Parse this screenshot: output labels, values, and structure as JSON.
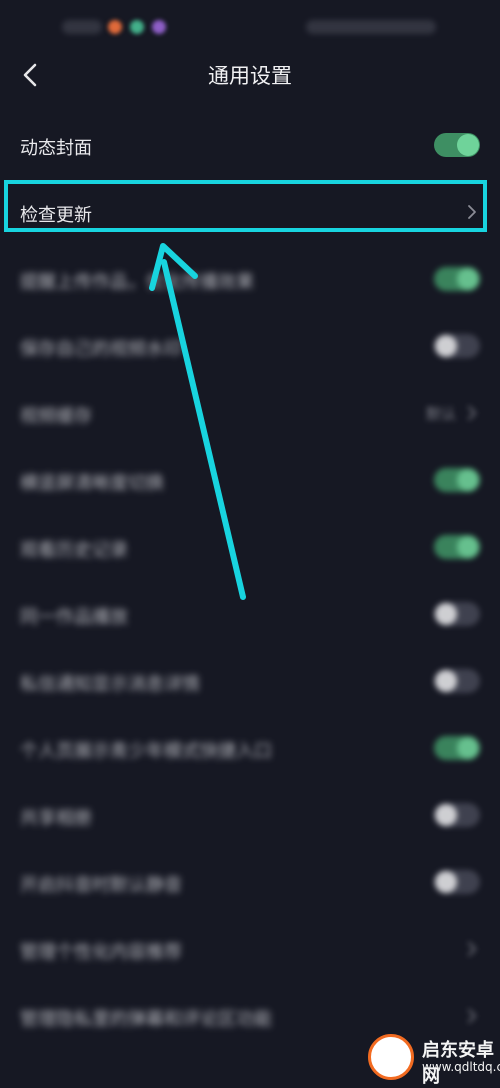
{
  "header": {
    "title": "通用设置"
  },
  "rows": [
    {
      "label": "动态封面",
      "control": "toggle",
      "on": true
    },
    {
      "label": "检查更新",
      "control": "chevron"
    },
    {
      "label": "提醒上传作品，优化传播效果",
      "control": "toggle",
      "on": true
    },
    {
      "label": "保存自己的视频水印",
      "control": "toggle",
      "on": false
    },
    {
      "label": "视频缓存",
      "control": "value-chevron",
      "value": "默认"
    },
    {
      "label": "横竖屏清晰度切换",
      "control": "toggle",
      "on": true
    },
    {
      "label": "观看历史记录",
      "control": "toggle",
      "on": true
    },
    {
      "label": "同一作品播放",
      "control": "toggle",
      "on": false
    },
    {
      "label": "私信通知显示消息详情",
      "control": "toggle",
      "on": false
    },
    {
      "label": "个人页展示青少年模式快捷入口",
      "control": "toggle",
      "on": true
    },
    {
      "label": "共享相册",
      "control": "toggle",
      "on": false
    },
    {
      "label": "开启抖音时默认静音",
      "control": "toggle",
      "on": false
    },
    {
      "label": "管理个性化内容推荐",
      "control": "chevron"
    },
    {
      "label": "管理隐私里的弹幕和评论区功能",
      "control": "chevron"
    }
  ],
  "watermark": {
    "name": "启东安卓网",
    "url": "www.qdltdq.com"
  }
}
